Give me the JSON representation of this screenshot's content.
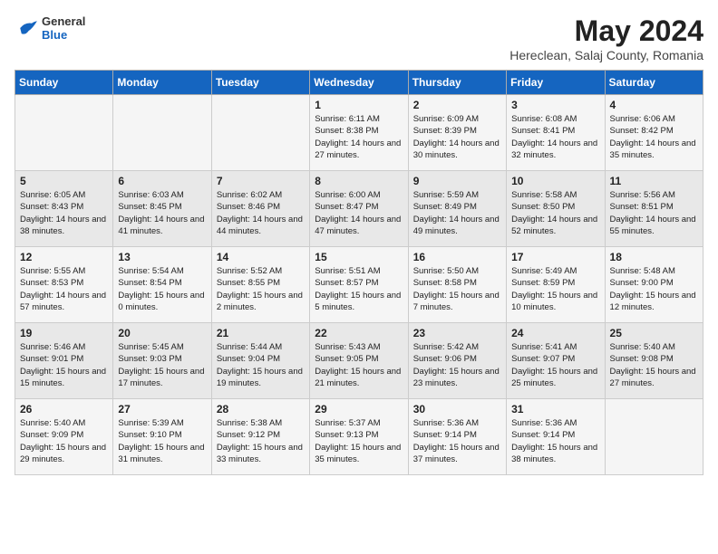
{
  "header": {
    "logo": {
      "general": "General",
      "blue": "Blue"
    },
    "title": "May 2024",
    "location": "Hereclean, Salaj County, Romania"
  },
  "weekdays": [
    "Sunday",
    "Monday",
    "Tuesday",
    "Wednesday",
    "Thursday",
    "Friday",
    "Saturday"
  ],
  "weeks": [
    [
      {
        "day": "",
        "sunrise": "",
        "sunset": "",
        "daylight": ""
      },
      {
        "day": "",
        "sunrise": "",
        "sunset": "",
        "daylight": ""
      },
      {
        "day": "",
        "sunrise": "",
        "sunset": "",
        "daylight": ""
      },
      {
        "day": "1",
        "sunrise": "Sunrise: 6:11 AM",
        "sunset": "Sunset: 8:38 PM",
        "daylight": "Daylight: 14 hours and 27 minutes."
      },
      {
        "day": "2",
        "sunrise": "Sunrise: 6:09 AM",
        "sunset": "Sunset: 8:39 PM",
        "daylight": "Daylight: 14 hours and 30 minutes."
      },
      {
        "day": "3",
        "sunrise": "Sunrise: 6:08 AM",
        "sunset": "Sunset: 8:41 PM",
        "daylight": "Daylight: 14 hours and 32 minutes."
      },
      {
        "day": "4",
        "sunrise": "Sunrise: 6:06 AM",
        "sunset": "Sunset: 8:42 PM",
        "daylight": "Daylight: 14 hours and 35 minutes."
      }
    ],
    [
      {
        "day": "5",
        "sunrise": "Sunrise: 6:05 AM",
        "sunset": "Sunset: 8:43 PM",
        "daylight": "Daylight: 14 hours and 38 minutes."
      },
      {
        "day": "6",
        "sunrise": "Sunrise: 6:03 AM",
        "sunset": "Sunset: 8:45 PM",
        "daylight": "Daylight: 14 hours and 41 minutes."
      },
      {
        "day": "7",
        "sunrise": "Sunrise: 6:02 AM",
        "sunset": "Sunset: 8:46 PM",
        "daylight": "Daylight: 14 hours and 44 minutes."
      },
      {
        "day": "8",
        "sunrise": "Sunrise: 6:00 AM",
        "sunset": "Sunset: 8:47 PM",
        "daylight": "Daylight: 14 hours and 47 minutes."
      },
      {
        "day": "9",
        "sunrise": "Sunrise: 5:59 AM",
        "sunset": "Sunset: 8:49 PM",
        "daylight": "Daylight: 14 hours and 49 minutes."
      },
      {
        "day": "10",
        "sunrise": "Sunrise: 5:58 AM",
        "sunset": "Sunset: 8:50 PM",
        "daylight": "Daylight: 14 hours and 52 minutes."
      },
      {
        "day": "11",
        "sunrise": "Sunrise: 5:56 AM",
        "sunset": "Sunset: 8:51 PM",
        "daylight": "Daylight: 14 hours and 55 minutes."
      }
    ],
    [
      {
        "day": "12",
        "sunrise": "Sunrise: 5:55 AM",
        "sunset": "Sunset: 8:53 PM",
        "daylight": "Daylight: 14 hours and 57 minutes."
      },
      {
        "day": "13",
        "sunrise": "Sunrise: 5:54 AM",
        "sunset": "Sunset: 8:54 PM",
        "daylight": "Daylight: 15 hours and 0 minutes."
      },
      {
        "day": "14",
        "sunrise": "Sunrise: 5:52 AM",
        "sunset": "Sunset: 8:55 PM",
        "daylight": "Daylight: 15 hours and 2 minutes."
      },
      {
        "day": "15",
        "sunrise": "Sunrise: 5:51 AM",
        "sunset": "Sunset: 8:57 PM",
        "daylight": "Daylight: 15 hours and 5 minutes."
      },
      {
        "day": "16",
        "sunrise": "Sunrise: 5:50 AM",
        "sunset": "Sunset: 8:58 PM",
        "daylight": "Daylight: 15 hours and 7 minutes."
      },
      {
        "day": "17",
        "sunrise": "Sunrise: 5:49 AM",
        "sunset": "Sunset: 8:59 PM",
        "daylight": "Daylight: 15 hours and 10 minutes."
      },
      {
        "day": "18",
        "sunrise": "Sunrise: 5:48 AM",
        "sunset": "Sunset: 9:00 PM",
        "daylight": "Daylight: 15 hours and 12 minutes."
      }
    ],
    [
      {
        "day": "19",
        "sunrise": "Sunrise: 5:46 AM",
        "sunset": "Sunset: 9:01 PM",
        "daylight": "Daylight: 15 hours and 15 minutes."
      },
      {
        "day": "20",
        "sunrise": "Sunrise: 5:45 AM",
        "sunset": "Sunset: 9:03 PM",
        "daylight": "Daylight: 15 hours and 17 minutes."
      },
      {
        "day": "21",
        "sunrise": "Sunrise: 5:44 AM",
        "sunset": "Sunset: 9:04 PM",
        "daylight": "Daylight: 15 hours and 19 minutes."
      },
      {
        "day": "22",
        "sunrise": "Sunrise: 5:43 AM",
        "sunset": "Sunset: 9:05 PM",
        "daylight": "Daylight: 15 hours and 21 minutes."
      },
      {
        "day": "23",
        "sunrise": "Sunrise: 5:42 AM",
        "sunset": "Sunset: 9:06 PM",
        "daylight": "Daylight: 15 hours and 23 minutes."
      },
      {
        "day": "24",
        "sunrise": "Sunrise: 5:41 AM",
        "sunset": "Sunset: 9:07 PM",
        "daylight": "Daylight: 15 hours and 25 minutes."
      },
      {
        "day": "25",
        "sunrise": "Sunrise: 5:40 AM",
        "sunset": "Sunset: 9:08 PM",
        "daylight": "Daylight: 15 hours and 27 minutes."
      }
    ],
    [
      {
        "day": "26",
        "sunrise": "Sunrise: 5:40 AM",
        "sunset": "Sunset: 9:09 PM",
        "daylight": "Daylight: 15 hours and 29 minutes."
      },
      {
        "day": "27",
        "sunrise": "Sunrise: 5:39 AM",
        "sunset": "Sunset: 9:10 PM",
        "daylight": "Daylight: 15 hours and 31 minutes."
      },
      {
        "day": "28",
        "sunrise": "Sunrise: 5:38 AM",
        "sunset": "Sunset: 9:12 PM",
        "daylight": "Daylight: 15 hours and 33 minutes."
      },
      {
        "day": "29",
        "sunrise": "Sunrise: 5:37 AM",
        "sunset": "Sunset: 9:13 PM",
        "daylight": "Daylight: 15 hours and 35 minutes."
      },
      {
        "day": "30",
        "sunrise": "Sunrise: 5:36 AM",
        "sunset": "Sunset: 9:14 PM",
        "daylight": "Daylight: 15 hours and 37 minutes."
      },
      {
        "day": "31",
        "sunrise": "Sunrise: 5:36 AM",
        "sunset": "Sunset: 9:14 PM",
        "daylight": "Daylight: 15 hours and 38 minutes."
      },
      {
        "day": "",
        "sunrise": "",
        "sunset": "",
        "daylight": ""
      }
    ]
  ]
}
